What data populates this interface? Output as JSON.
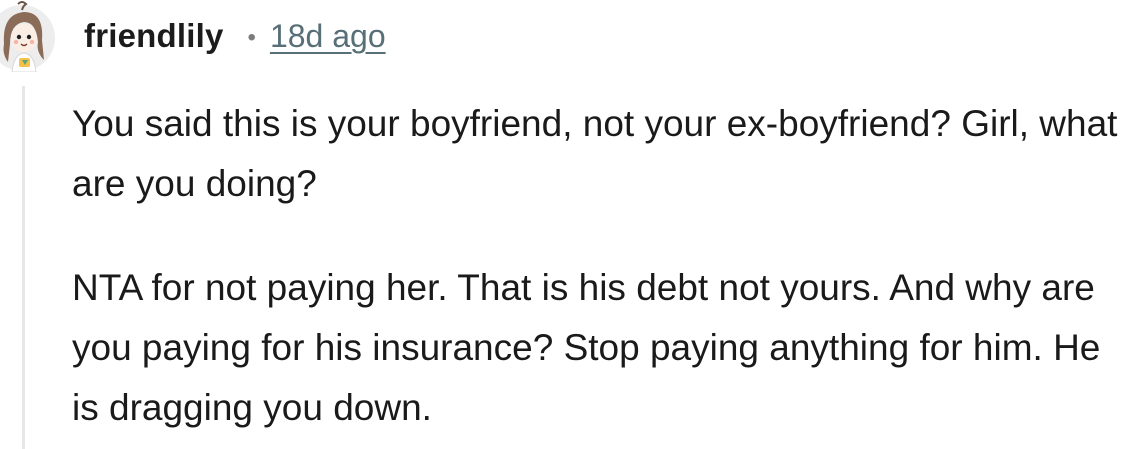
{
  "comment": {
    "author": "friendlily",
    "separator": "•",
    "timestamp": "18d ago",
    "avatar_icon": "girl-avatar-icon",
    "paragraphs": [
      "You said this is your boyfriend, not your ex-boyfriend? Girl, what are you doing?",
      "NTA for not paying her. That is his debt not yours. And why are you paying for his insurance? Stop paying anything for him. He is dragging you down."
    ]
  }
}
